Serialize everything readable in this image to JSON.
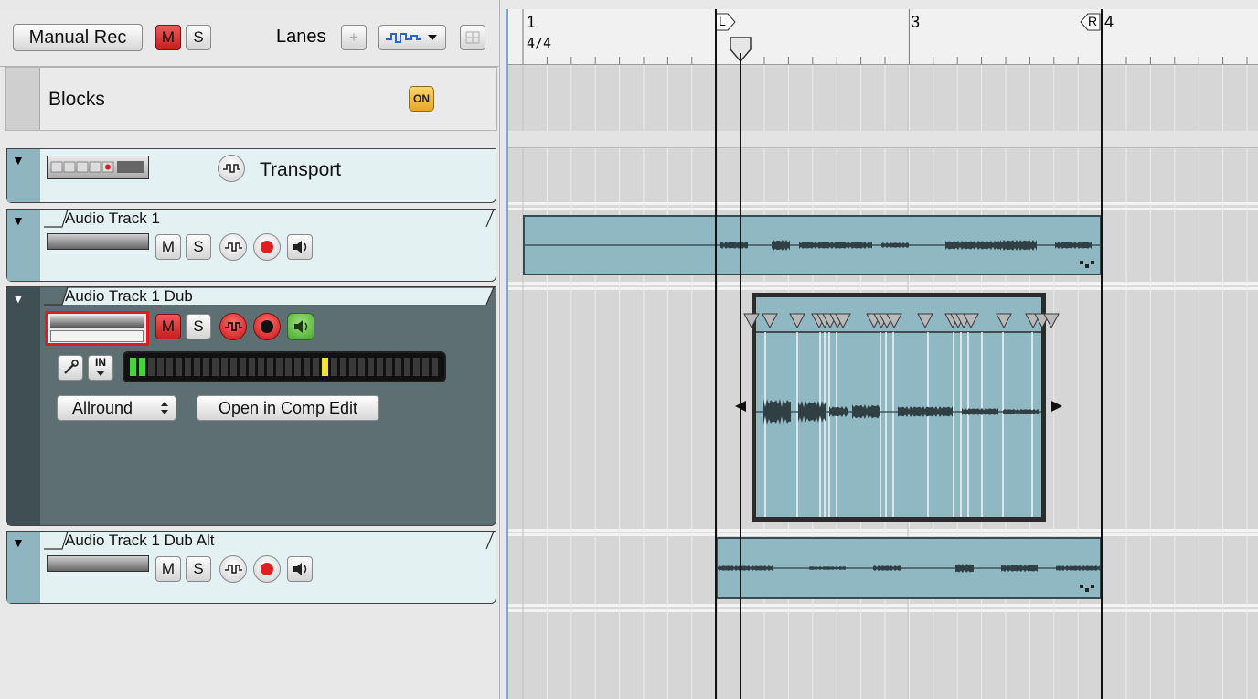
{
  "toolbar": {
    "rec_mode_label": "Manual Rec",
    "mute_label": "M",
    "solo_label": "S",
    "lanes_label": "Lanes",
    "add_icon": "plus-icon",
    "lane_mode_icon": "waveform-dropdown-icon",
    "grid_icon": "grid-icon"
  },
  "blocks": {
    "label": "Blocks",
    "toggle_label": "ON"
  },
  "transport": {
    "label": "Transport"
  },
  "tracks": [
    {
      "name": "Audio Track 1",
      "mute": "M",
      "solo": "S"
    },
    {
      "name": "Audio Track 1 Dub",
      "mute": "M",
      "solo": "S",
      "in_label": "IN",
      "preset": "Allround",
      "comp_button": "Open in Comp Edit"
    },
    {
      "name": "Audio Track 1 Dub Alt",
      "mute": "M",
      "solo": "S"
    }
  ],
  "ruler": {
    "bar_1": "1",
    "time_signature": "4/4",
    "bar_3": "3",
    "bar_4": "4",
    "left_locator": "L",
    "right_locator": "R"
  },
  "colors": {
    "clip_fill": "#8fb8c3",
    "dub_panel": "#5e6f74",
    "panel_bg": "#e4f1f3",
    "record_red": "#d81e1e",
    "blocks_on": "#f2b53c"
  }
}
